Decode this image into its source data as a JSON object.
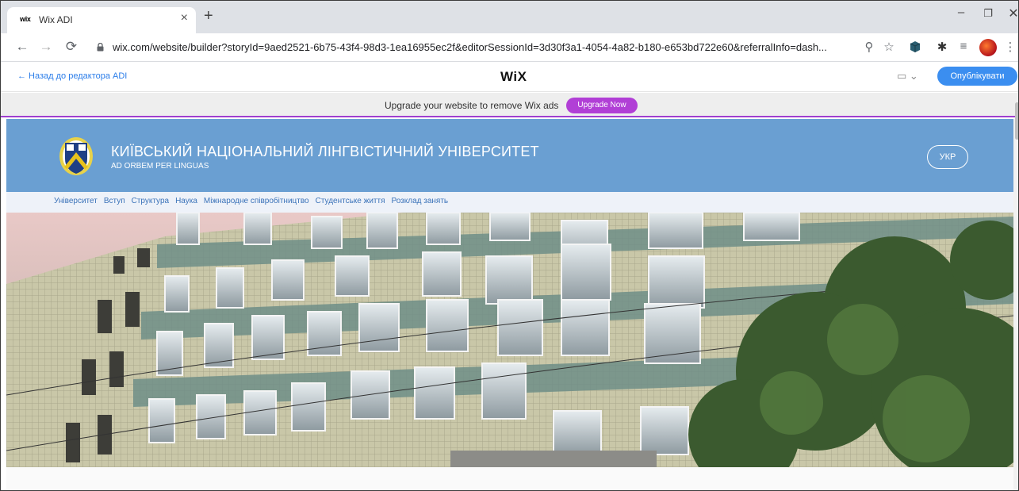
{
  "browser": {
    "tab": {
      "favicon": "wix",
      "title": "Wix ADI"
    },
    "new_tab": "+",
    "url": "wix.com/website/builder?storyId=9aed2521-6b75-43f4-98d3-1ea16955ec2f&editorSessionId=3d30f3a1-4054-4a82-b180-e653bd722e60&referralInfo=dash..."
  },
  "editor": {
    "back_link": "← Назад до редактора ADI",
    "logo": "WiX",
    "publish_label": "Опублікувати"
  },
  "ad_bar": {
    "text": "Upgrade your website to remove Wix ads",
    "button": "Upgrade Now"
  },
  "site": {
    "title": "КИЇВСЬКИЙ НАЦІОНАЛЬНИЙ ЛІНГВІСТИЧНИЙ УНІВЕРСИТЕТ",
    "motto": "AD ORBEM PER LINGUAS",
    "lang": "УКР",
    "nav": [
      "Університет",
      "Вступ",
      "Структура",
      "Наука",
      "Міжнародне співробітництво",
      "Студентське життя",
      "Розклад занять"
    ],
    "header_color": "#6a9fd2"
  },
  "icons": {
    "back": "back-arrow-icon",
    "forward": "forward-arrow-icon",
    "reload": "reload-icon",
    "lock": "lock-icon",
    "zoom": "zoom-icon",
    "star": "bookmark-star-icon",
    "extensions": "puzzle-icon",
    "device": "desktop-icon"
  }
}
